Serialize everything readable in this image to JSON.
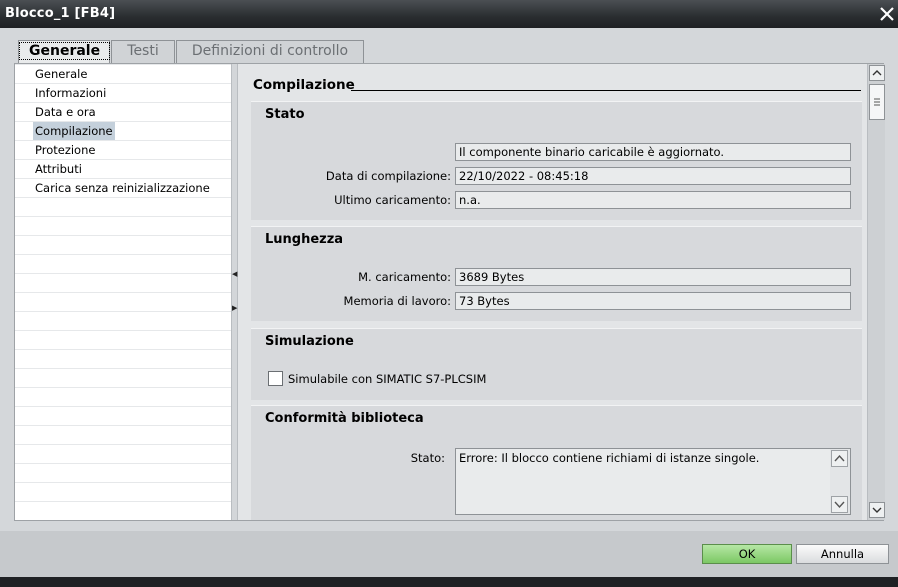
{
  "window": {
    "title": "Blocco_1 [FB4]",
    "close_icon": "close-icon"
  },
  "tabs": [
    {
      "label": "Generale",
      "active": true
    },
    {
      "label": "Testi",
      "active": false
    },
    {
      "label": "Definizioni di controllo",
      "active": false
    }
  ],
  "nav": {
    "items": [
      {
        "label": "Generale"
      },
      {
        "label": "Informazioni"
      },
      {
        "label": "Data e ora"
      },
      {
        "label": "Compilazione",
        "selected": true
      },
      {
        "label": "Protezione"
      },
      {
        "label": "Attributi"
      },
      {
        "label": "Carica senza reinizializzazione"
      }
    ]
  },
  "content": {
    "section_title": "Compilazione",
    "stato": {
      "title": "Stato",
      "status_value": "Il componente binario caricabile è aggiornato.",
      "compile_date_label": "Data di compilazione:",
      "compile_date_value": "22/10/2022 - 08:45:18",
      "last_load_label": "Ultimo caricamento:",
      "last_load_value": "n.a."
    },
    "lunghezza": {
      "title": "Lunghezza",
      "load_mem_label": "M. caricamento:",
      "load_mem_value": "3689 Bytes",
      "work_mem_label": "Memoria di lavoro:",
      "work_mem_value": "73 Bytes"
    },
    "simulazione": {
      "title": "Simulazione",
      "checkbox_label": "Simulabile con SIMATIC S7-PLCSIM",
      "checked": false
    },
    "conformita": {
      "title": "Conformità biblioteca",
      "stato_label": "Stato:",
      "stato_value": "Errore: Il blocco contiene richiami di istanze singole."
    }
  },
  "footer": {
    "ok_label": "OK",
    "cancel_label": "Annulla"
  },
  "colors": {
    "ok_button": "#8fd477",
    "selected_nav": "#c4d0db",
    "titlebar": "#2a2d30"
  }
}
